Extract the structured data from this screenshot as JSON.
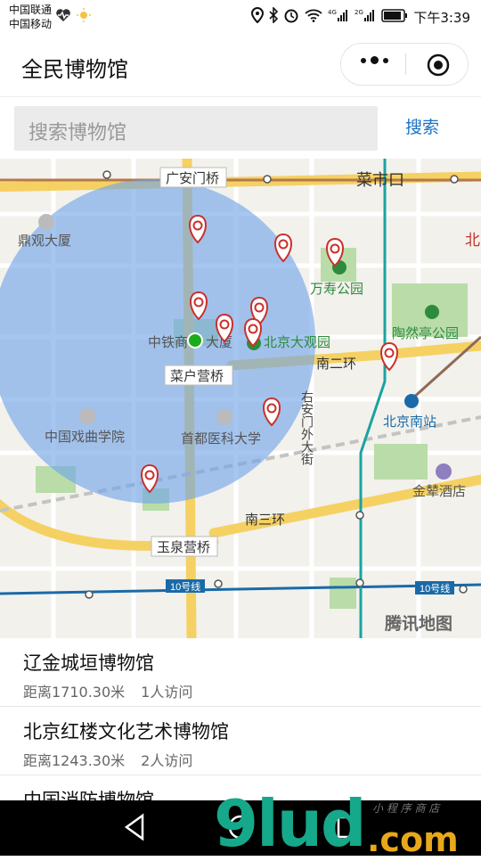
{
  "status_bar": {
    "carrier_1": "中国联通",
    "carrier_2": "中国移动",
    "time": "下午3:39"
  },
  "nav": {
    "title": "全民博物馆"
  },
  "search": {
    "placeholder": "搜索博物馆",
    "button_label": "搜索"
  },
  "map": {
    "labels": {
      "guanganmen": "广安门桥",
      "caishikou": "菜市口",
      "dingguan": "鼎观大厦",
      "wanshou": "万寿公园",
      "taoranting": "陶然亭公园",
      "zhongtie": "中铁商",
      "zhongtie_b": "大厦",
      "daguanyuan": "北京大观园",
      "ner": "南二环",
      "caihuying": "菜户营桥",
      "youanmen": "右安门外大街",
      "beijingnan": "北京南站",
      "xiqu": "中国戏曲学院",
      "shoudu": "首都医科大学",
      "jinqin": "金辇酒店",
      "nansan": "南三环",
      "yuquanying": "玉泉营桥",
      "line10a": "10号线",
      "line10b": "10号线",
      "bei": "北",
      "tencent": "腾讯地图"
    },
    "colors": {
      "circle": "#6fa3ea",
      "marker": "#c9302c",
      "user": "#1aad19"
    }
  },
  "museums": [
    {
      "name": "辽金城垣博物馆",
      "distance": "距离1710.30米",
      "visits": "1人访问"
    },
    {
      "name": "北京红楼文化艺术博物馆",
      "distance": "距离1243.30米",
      "visits": "2人访问"
    },
    {
      "name": "中国消防博物馆",
      "distance": "",
      "visits": ""
    }
  ],
  "watermark": {
    "main": "9lud",
    "com": ".com",
    "small": "小 程 序 商 店"
  },
  "system_nav": {
    "icons": [
      "back-icon",
      "home-icon",
      "recents-icon"
    ]
  }
}
